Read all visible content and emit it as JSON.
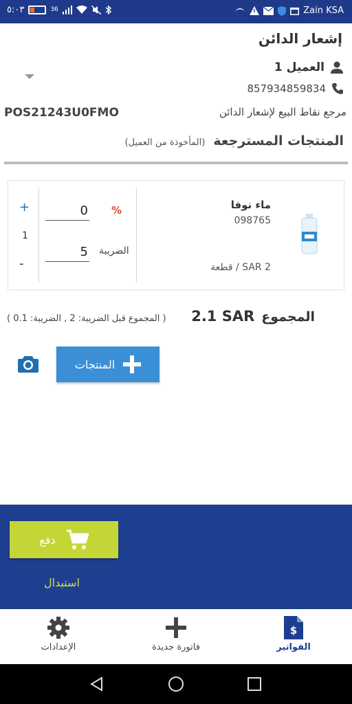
{
  "status_bar": {
    "time": "٥:٠٣",
    "network": "36",
    "carrier": "Zain KSA",
    "battery_level": 0.25,
    "battery_color": "#ff6b2b"
  },
  "page": {
    "title": "إشعار الدائن"
  },
  "client": {
    "name": "العميل 1",
    "phone": "857934859834"
  },
  "reference": {
    "label": "مرجع نقاط البيع لإشعار الدائن",
    "value": "POS21243U0FMO"
  },
  "returned_section": {
    "title": "المنتجات المسترجعة",
    "subtitle": "(المأخوذة من العميل)"
  },
  "product": {
    "name": "ماء نوفا",
    "code": "098765",
    "price": "SAR 2 / قطعة",
    "discount_symbol": "%",
    "discount_value": "0",
    "tax_label": "الضريبة",
    "tax_value": "5",
    "quantity": "1",
    "plus": "+",
    "minus": "-"
  },
  "totals": {
    "label": "المجموع",
    "value": "2.1 SAR",
    "detail": "( المجموع قبل الضريبة: 2 , الضريبة: 0.1 )"
  },
  "actions": {
    "products_label": "المنتجات",
    "pay_label": "دفع",
    "replace_label": "استبدال"
  },
  "bottom_nav": {
    "settings": "الإعدادات",
    "new_invoice": "فاتورة جديدة",
    "invoices": "الفواتير"
  },
  "colors": {
    "primary": "#1e3f8f",
    "accent_blue": "#3b8fd6",
    "pay_green": "#c3d636",
    "replace_yellow": "#d6e23f",
    "discount_red": "#d64b3a"
  }
}
